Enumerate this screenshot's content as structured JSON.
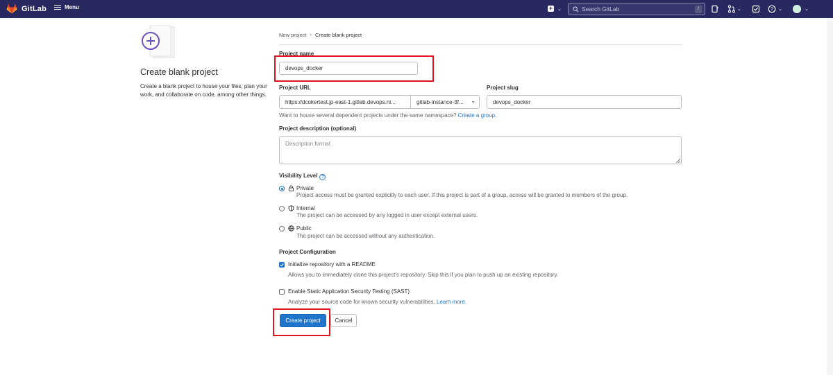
{
  "nav": {
    "brand": "GitLab",
    "menu_label": "Menu",
    "search_placeholder": "Search GitLab",
    "search_shortcut": "/"
  },
  "left": {
    "title": "Create blank project",
    "description": "Create a blank project to house your files, plan your work, and collaborate on code, among other things."
  },
  "breadcrumb": {
    "parent": "New project",
    "current": "Create blank project"
  },
  "form": {
    "project_name_label": "Project name",
    "project_name_value": "devops_docker",
    "project_url_label": "Project URL",
    "project_url_value": "https://dcokertest.jp-east-1.gitlab.devops.ni...",
    "namespace_value": "gitlab-instance-3f...",
    "project_slug_label": "Project slug",
    "project_slug_value": "devops_docker",
    "namespace_hint": "Want to house several dependent projects under the same namespace?",
    "create_group_link": "Create a group.",
    "description_label": "Project description (optional)",
    "description_placeholder": "Description format",
    "visibility_label": "Visibility Level",
    "visibility_options": [
      {
        "label": "Private",
        "desc": "Project access must be granted explicitly to each user. If this project is part of a group, access will be granted to members of the group.",
        "selected": true
      },
      {
        "label": "Internal",
        "desc": "The project can be accessed by any logged in user except external users.",
        "selected": false
      },
      {
        "label": "Public",
        "desc": "The project can be accessed without any authentication.",
        "selected": false
      }
    ],
    "config_label": "Project Configuration",
    "readme_label": "Initialize repository with a README",
    "readme_desc": "Allows you to immediately clone this project’s repository. Skip this if you plan to push up an existing repository.",
    "readme_checked": true,
    "sast_label": "Enable Static Application Security Testing (SAST)",
    "sast_desc": "Analyze your source code for known security vulnerabilities.",
    "sast_link": "Learn more.",
    "sast_checked": false,
    "create_button": "Create project",
    "cancel_button": "Cancel"
  },
  "colors": {
    "nav_bg": "#292961",
    "primary": "#1f75cb",
    "highlight": "#e0141e"
  }
}
